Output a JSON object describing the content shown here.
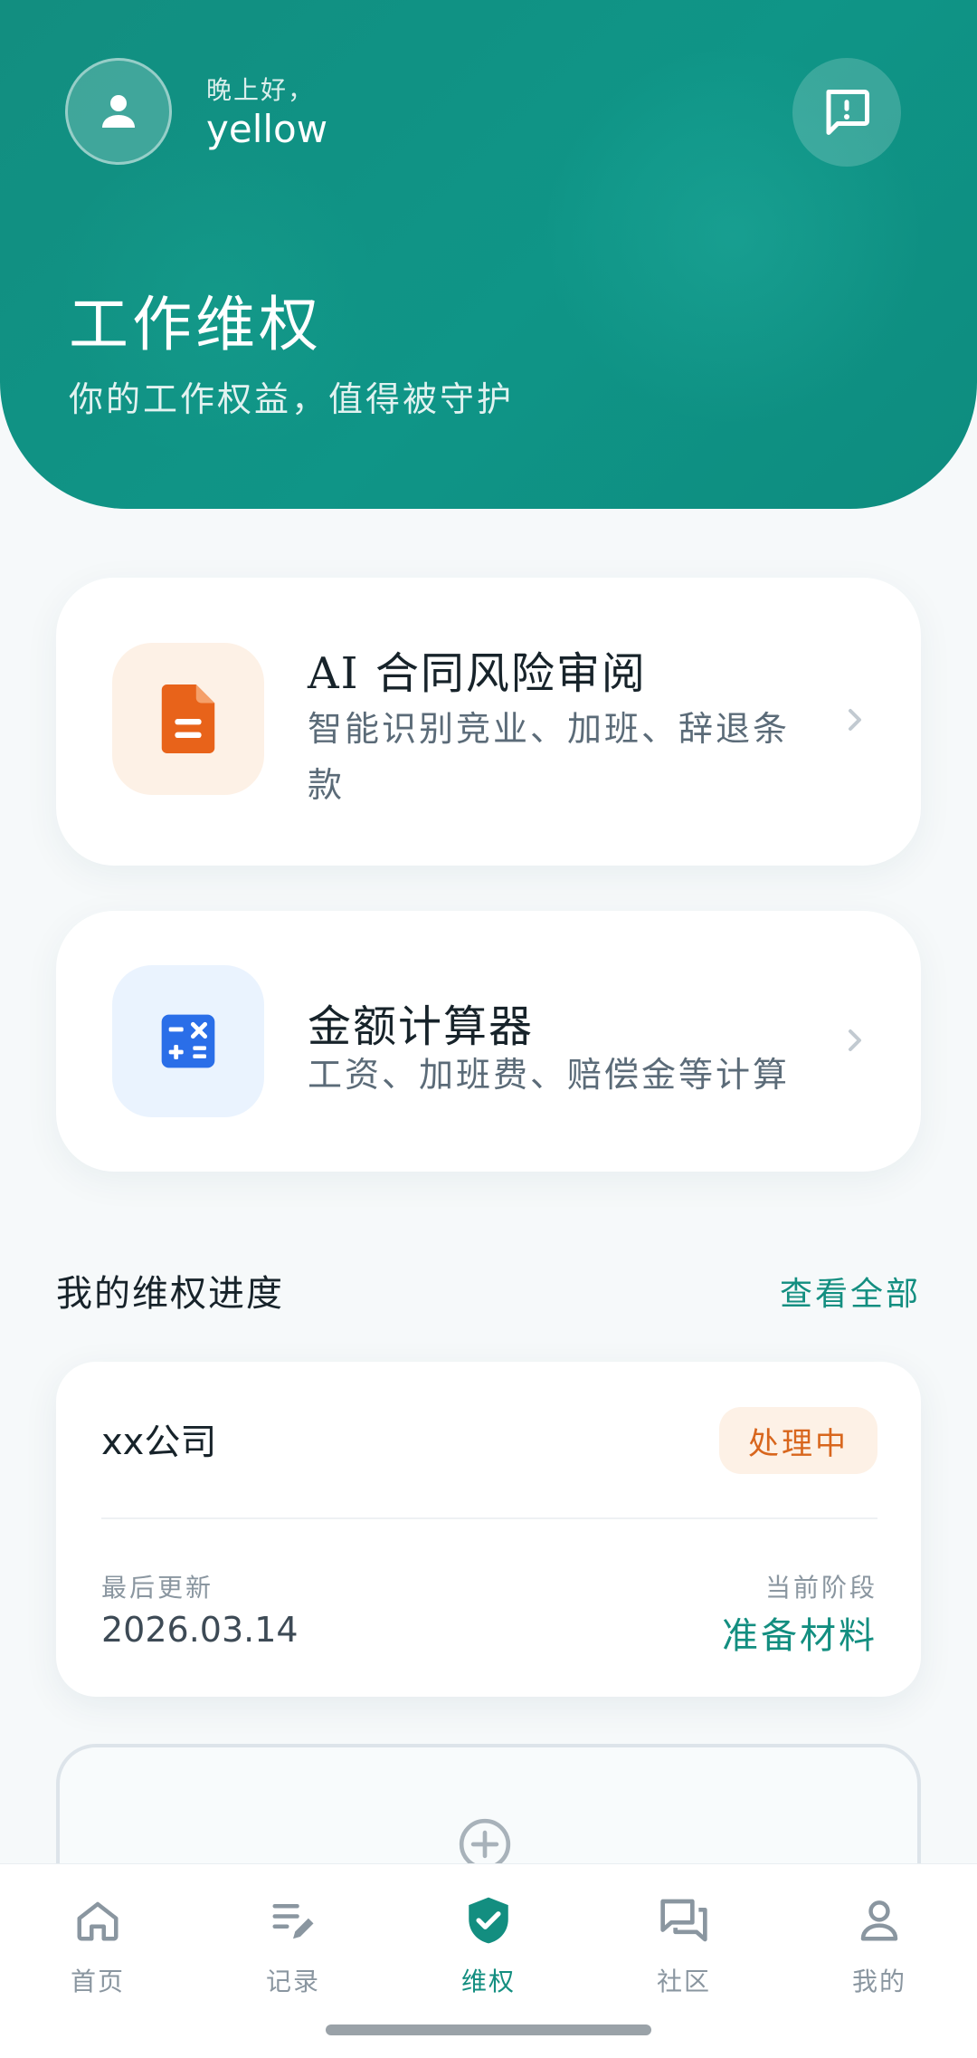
{
  "header": {
    "greeting": "晚上好，",
    "username": "yellow",
    "title": "工作维权",
    "subtitle": "你的工作权益，值得被守护",
    "brand_color": "#128e80"
  },
  "features": {
    "contract_review": {
      "title": "AI 合同风险审阅",
      "description": "智能识别竞业、加班、辞退条款",
      "icon": "document-icon",
      "icon_color": "#e8631a"
    },
    "calculator": {
      "title": "金额计算器",
      "description": "工资、加班费、赔偿金等计算",
      "icon": "calculator-icon",
      "icon_color": "#2a6ee8"
    }
  },
  "progress_section": {
    "title": "我的维权进度",
    "view_all": "查看全部",
    "cases": [
      {
        "company": "xx公司",
        "status": "处理中",
        "last_update_label": "最后更新",
        "last_update": "2026.03.14",
        "stage_label": "当前阶段",
        "stage": "准备材料"
      }
    ]
  },
  "bottom_nav": {
    "items": [
      {
        "label": "首页",
        "icon": "home-icon"
      },
      {
        "label": "记录",
        "icon": "edit-list-icon"
      },
      {
        "label": "维权",
        "icon": "shield-check-icon",
        "active": true
      },
      {
        "label": "社区",
        "icon": "chat-bubbles-icon"
      },
      {
        "label": "我的",
        "icon": "person-icon"
      }
    ]
  }
}
